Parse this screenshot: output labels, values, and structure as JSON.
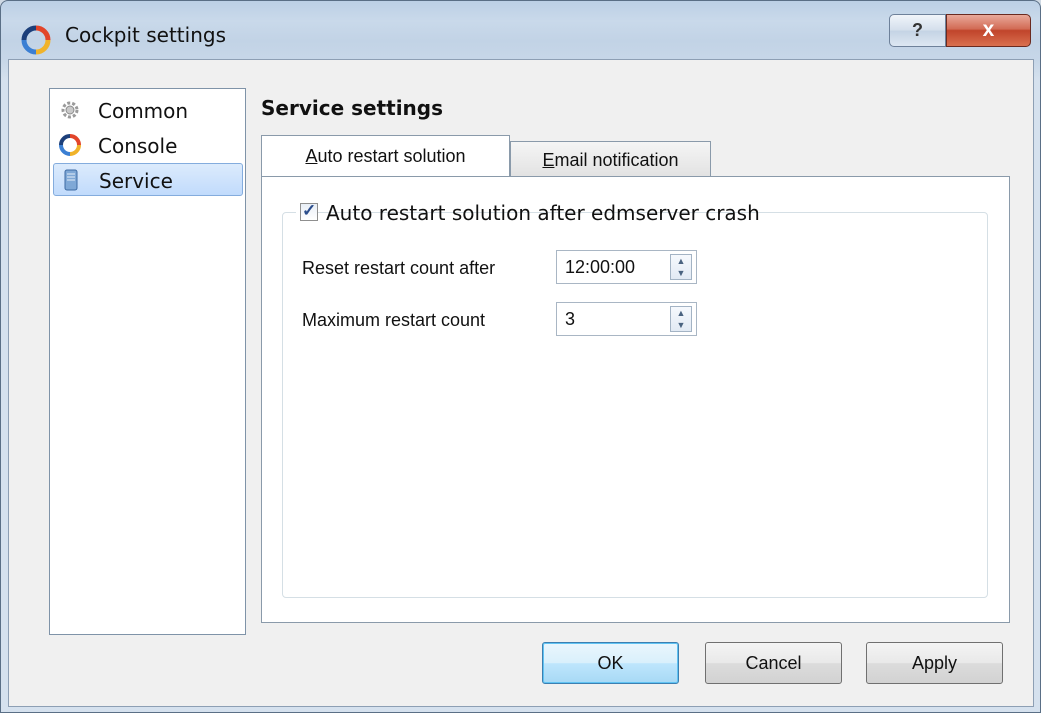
{
  "window": {
    "title": "Cockpit settings",
    "help_label": "?",
    "close_label": "x"
  },
  "sidebar": {
    "items": [
      {
        "label": "Common",
        "icon": "gear-icon",
        "selected": false
      },
      {
        "label": "Console",
        "icon": "cockpit-icon",
        "selected": false
      },
      {
        "label": "Service",
        "icon": "service-icon",
        "selected": true
      }
    ]
  },
  "main": {
    "section_title": "Service settings",
    "tabs": [
      {
        "label_mnemonic": "A",
        "label_rest": "uto restart solution",
        "active": true
      },
      {
        "label_mnemonic": "E",
        "label_rest": "mail notification",
        "active": false
      }
    ],
    "group": {
      "checkbox_label": "Auto restart solution after edmserver crash",
      "checked": true
    },
    "fields": {
      "reset_label": "Reset restart count after",
      "reset_value": "12:00:00",
      "max_label": "Maximum restart count",
      "max_value": "3"
    }
  },
  "buttons": {
    "ok": "OK",
    "cancel": "Cancel",
    "apply": "Apply"
  },
  "colors": {
    "selection": "#c1dbfc",
    "close_red": "#c0442b",
    "default_button": "#bee6fd"
  }
}
